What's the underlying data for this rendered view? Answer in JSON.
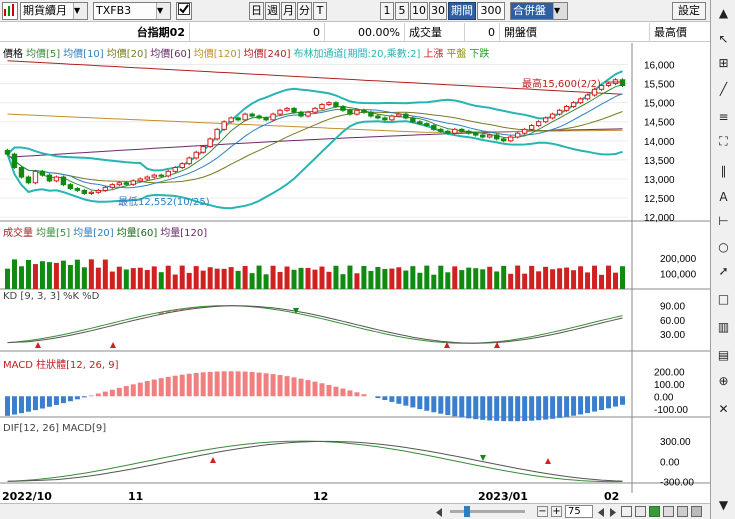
{
  "toolbar": {
    "period": "期貨續月",
    "symbol": "TXFB3",
    "btn_day": "日",
    "btn_week": "週",
    "btn_month": "月",
    "btn_min": "分",
    "btn_tick": "T",
    "n1": "1",
    "n5": "5",
    "n10": "10",
    "n30": "30",
    "range_label": "期間",
    "range_value": "300",
    "session": "合併盤",
    "settings": "設定"
  },
  "info": {
    "name": "台指期02",
    "last": "0",
    "pct": "00.00%",
    "vol_label": "成交量",
    "vol_value": "0",
    "open_label": "開盤價",
    "high_label": "最高價"
  },
  "legends": {
    "price": [
      {
        "text": "價格",
        "color": "#000000"
      },
      {
        "text": "均價[5]",
        "color": "#3a8a3a"
      },
      {
        "text": "均價[10]",
        "color": "#2f7fc0"
      },
      {
        "text": "均價[20]",
        "color": "#7a7a20"
      },
      {
        "text": "均價[60]",
        "color": "#6a2a6a"
      },
      {
        "text": "均價[120]",
        "color": "#c0902a"
      },
      {
        "text": "均價[240]",
        "color": "#b02020"
      },
      {
        "text": "布林加通道[期間:20,乘數:2]",
        "color": "#27b4b4"
      },
      {
        "text": "上漲",
        "color": "#c02020"
      },
      {
        "text": "平盤",
        "color": "#8a8a00"
      },
      {
        "text": "下跌",
        "color": "#20a020"
      }
    ],
    "volume": [
      {
        "text": "成交量",
        "color": "#a02020"
      },
      {
        "text": "均量[5]",
        "color": "#3a8a3a"
      },
      {
        "text": "均量[20]",
        "color": "#2f7fc0"
      },
      {
        "text": "均量[60]",
        "color": "#1a6a1a"
      },
      {
        "text": "均量[120]",
        "color": "#6a2a6a"
      }
    ],
    "kd": [
      {
        "text": "KD [9, 3, 3]",
        "color": "#444444"
      },
      {
        "text": "%K",
        "color": "#444444"
      },
      {
        "text": "%D",
        "color": "#444444"
      }
    ],
    "macd": [
      {
        "text": "MACD 柱狀體[12, 26, 9]",
        "color": "#c02020"
      }
    ],
    "dif": [
      {
        "text": "DIF[12, 26]",
        "color": "#444444"
      },
      {
        "text": "MACD[9]",
        "color": "#444444"
      }
    ]
  },
  "annotations": {
    "high": "最高15,600(2/2)",
    "low": "最低12,552(10/25)"
  },
  "axes": {
    "price_ticks": [
      "16,000",
      "15,500",
      "15,000",
      "14,500",
      "14,000",
      "13,500",
      "13,000",
      "12,500",
      "12,000"
    ],
    "vol_ticks": [
      "200,000",
      "100,000"
    ],
    "kd_ticks": [
      "90.00",
      "60.00",
      "30.00"
    ],
    "macd_ticks": [
      "200.00",
      "100.00",
      "0.00",
      "-100.00"
    ],
    "dif_ticks": [
      "300.00",
      "0.00",
      "-300.00"
    ],
    "dates": [
      "2022/10",
      "11",
      "12",
      "2023/01",
      "02"
    ]
  },
  "bottom": {
    "zoom": "75"
  },
  "chart_data": {
    "type": "candlestick",
    "note_series": "approximate daily OHLC readings",
    "price_range": [
      11950,
      16250
    ],
    "closes": [
      13650,
      13300,
      13050,
      12900,
      13200,
      13100,
      12950,
      13050,
      12850,
      12750,
      12700,
      12620,
      12650,
      12700,
      12780,
      12850,
      12900,
      12860,
      12950,
      13000,
      13050,
      13100,
      13080,
      13200,
      13300,
      13400,
      13550,
      13700,
      13850,
      14050,
      14300,
      14500,
      14600,
      14550,
      14700,
      14650,
      14600,
      14550,
      14700,
      14800,
      14850,
      14750,
      14650,
      14750,
      14850,
      14950,
      15000,
      14900,
      14800,
      14700,
      14800,
      14750,
      14650,
      14600,
      14550,
      14650,
      14700,
      14600,
      14500,
      14450,
      14400,
      14300,
      14250,
      14200,
      14300,
      14250,
      14200,
      14150,
      14100,
      14150,
      14050,
      14000,
      14100,
      14200,
      14300,
      14400,
      14500,
      14600,
      14700,
      14800,
      14900,
      15000,
      15100,
      15200,
      15350,
      15450,
      15500,
      15600,
      15450
    ]
  }
}
